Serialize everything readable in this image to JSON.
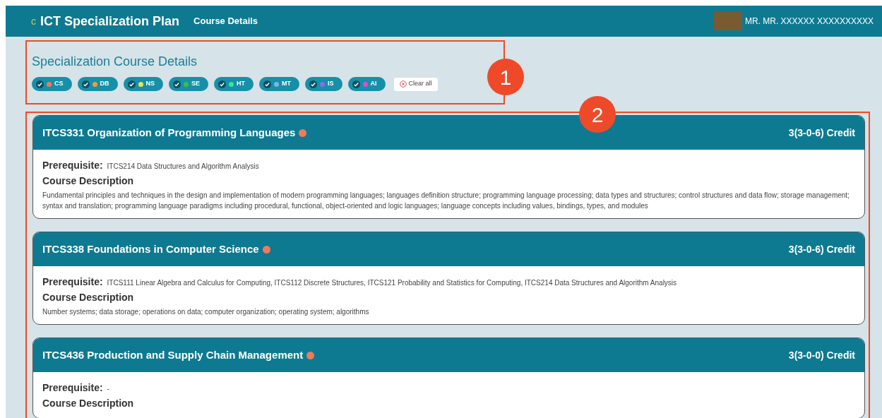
{
  "header": {
    "logo_text": "c",
    "title": "ICT Specialization Plan",
    "subtitle": "Course Details",
    "user_name": "MR. MR. XXXXXX XXXXXXXXXX"
  },
  "filter_panel": {
    "title": "Specialization Course Details",
    "clear_label": "Clear all",
    "chips": [
      {
        "label": "CS",
        "checked": true,
        "color": "#f07a5a"
      },
      {
        "label": "DB",
        "checked": true,
        "color": "#f39c32"
      },
      {
        "label": "NS",
        "checked": true,
        "color": "#f2e24a"
      },
      {
        "label": "SE",
        "checked": true,
        "color": "#3cc03c"
      },
      {
        "label": "HT",
        "checked": true,
        "color": "#3ee0a0"
      },
      {
        "label": "MT",
        "checked": true,
        "color": "#7ab4e8"
      },
      {
        "label": "IS",
        "checked": true,
        "color": "#8a6cf0"
      },
      {
        "label": "AI",
        "checked": true,
        "color": "#e04ad8"
      }
    ]
  },
  "courses": [
    {
      "title": "ITCS331 Organization of Programming Languages",
      "color": "#f07a5a",
      "credit": "3(3-0-6) Credit",
      "prerequisite_label": "Prerequisite:",
      "prerequisite": "ITCS214 Data Structures and Algorithm Analysis",
      "description_label": "Course Description",
      "description": "Fundamental principles and techniques in the design and implementation of modern programming languages; languages definition structure; programming language processing; data types and structures; control structures and data flow; storage management; syntax and translation; programming language paradigms including procedural, functional, object-oriented and logic languages; language concepts including values, bindings, types, and modules"
    },
    {
      "title": "ITCS338 Foundations in Computer Science",
      "color": "#f07a5a",
      "credit": "3(3-0-6) Credit",
      "prerequisite_label": "Prerequisite:",
      "prerequisite": "ITCS111 Linear Algebra and Calculus for Computing, ITCS112 Discrete Structures, ITCS121 Probability and Statistics for Computing, ITCS214 Data Structures and Algorithm Analysis",
      "description_label": "Course Description",
      "description": "Number systems; data storage; operations on data; computer organization; operating system; algorithms"
    },
    {
      "title": "ITCS436 Production and Supply Chain Management",
      "color": "#f07a5a",
      "credit": "3(3-0-0) Credit",
      "prerequisite_label": "Prerequisite:",
      "prerequisite": "-",
      "description_label": "Course Description"
    }
  ],
  "annotations": [
    {
      "number": "1"
    },
    {
      "number": "2"
    }
  ]
}
